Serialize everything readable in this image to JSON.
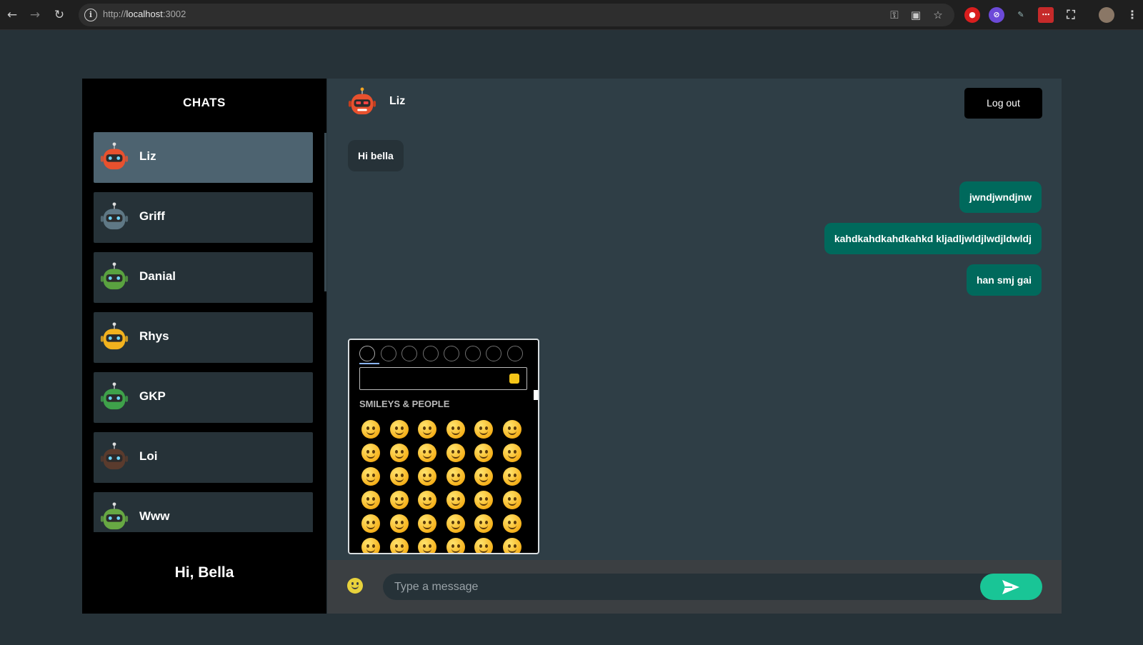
{
  "browser": {
    "url_scheme": "http://",
    "url_host": "localhost",
    "url_port": ":3002"
  },
  "sidebar": {
    "title": "CHATS",
    "contacts": [
      {
        "name": "Liz",
        "avatar_color": "#e8512e",
        "active": true
      },
      {
        "name": "Griff",
        "avatar_color": "#5f7885",
        "active": false
      },
      {
        "name": "Danial",
        "avatar_color": "#5aa240",
        "active": false
      },
      {
        "name": "Rhys",
        "avatar_color": "#f2b21e",
        "active": false
      },
      {
        "name": "GKP",
        "avatar_color": "#3fa14a",
        "active": false
      },
      {
        "name": "Loi",
        "avatar_color": "#5a3b2d",
        "active": false
      },
      {
        "name": "Www",
        "avatar_color": "#67a843",
        "active": false
      }
    ],
    "greeting": "Hi, Bella"
  },
  "chat": {
    "contact_name": "Liz",
    "logout_label": "Log out",
    "messages": [
      {
        "text": "Hi bella",
        "direction": "incoming"
      },
      {
        "text": "jwndjwndjnw",
        "direction": "outgoing"
      },
      {
        "text": "kahdkahdkahdkahkd kljadljwldjlwdjldwldj",
        "direction": "outgoing"
      },
      {
        "text": "han smj gai",
        "direction": "outgoing"
      }
    ],
    "input_placeholder": "Type a message"
  },
  "emoji_picker": {
    "category_label": "SMILEYS & PEOPLE",
    "categories": [
      "smileys-icon",
      "animals-icon",
      "food-icon",
      "travel-icon",
      "activity-icon",
      "objects-icon",
      "symbols-icon",
      "flags-icon"
    ]
  },
  "colors": {
    "accent_send": "#19c596",
    "outgoing_bubble": "#00695c",
    "active_contact": "#4d6370"
  }
}
